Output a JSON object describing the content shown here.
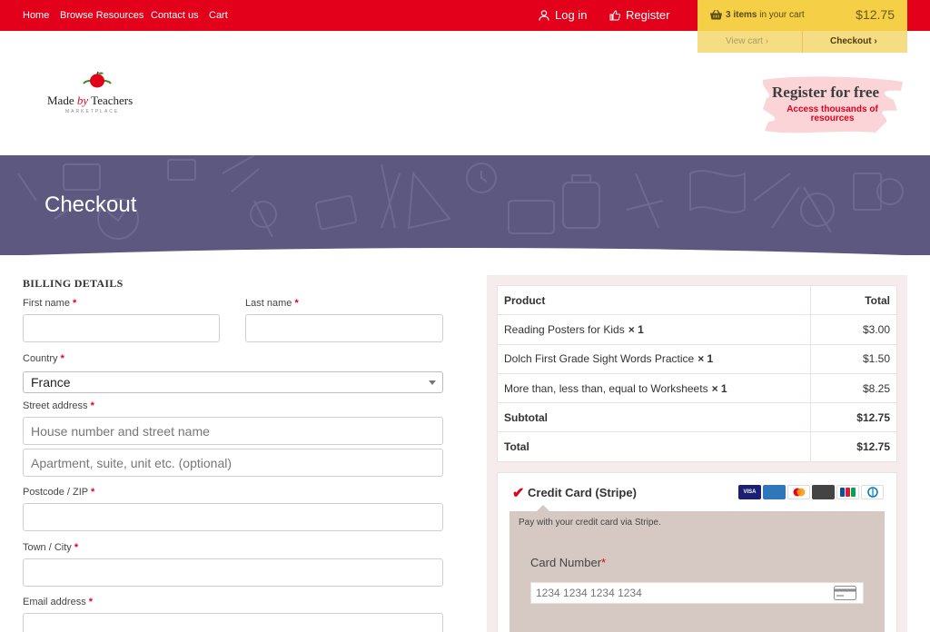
{
  "nav": {
    "home": "Home",
    "browse": "Browse Resources",
    "contact": "Contact us",
    "cart": "Cart",
    "login": "Log in",
    "register": "Register"
  },
  "minicart": {
    "items_count": "3 items",
    "items_suffix": "in your cart",
    "total": "$12.75",
    "view_cart": "View cart",
    "checkout": "Checkout"
  },
  "header": {
    "logo_made": "Made ",
    "logo_by": "by",
    "logo_teachers": " Teachers",
    "logo_sub": "MARKETPLACE",
    "promo_title": "Register for free",
    "promo_desc": "Access thousands of resources"
  },
  "page": {
    "title": "Checkout"
  },
  "billing": {
    "heading": "BILLING DETAILS",
    "first_name_label": "First name",
    "last_name_label": "Last name",
    "country_label": "Country",
    "country_value": "France",
    "street_label": "Street address",
    "street_placeholder": "House number and street name",
    "street2_placeholder": "Apartment, suite, unit etc. (optional)",
    "postcode_label": "Postcode / ZIP",
    "city_label": "Town / City",
    "email_label": "Email address",
    "required_mark": "*"
  },
  "order": {
    "col_product": "Product",
    "col_total": "Total",
    "items": [
      {
        "name": "Reading Posters for Kids",
        "qty": "× 1",
        "total": "$3.00"
      },
      {
        "name": "Dolch First Grade Sight Words Practice",
        "qty": "× 1",
        "total": "$1.50"
      },
      {
        "name": "More than, less than, equal to Worksheets",
        "qty": "× 1",
        "total": "$8.25"
      }
    ],
    "subtotal_label": "Subtotal",
    "subtotal": "$12.75",
    "total_label": "Total",
    "total": "$12.75"
  },
  "payment": {
    "method": "Credit Card (Stripe)",
    "description": "Pay with your credit card via Stripe.",
    "card_number_label": "Card Number",
    "card_number_placeholder": "1234 1234 1234 1234",
    "card_brands": [
      "VISA",
      "AMEX",
      "MC",
      "DISCOVER",
      "JCB",
      "DINERS"
    ]
  },
  "colors": {
    "brand_red": "#e2001a",
    "cart_yellow": "#f5cf45",
    "banner_purple": "#5c5880",
    "review_bg": "#f5eceb",
    "paybox_bg": "#d6c8c3"
  }
}
